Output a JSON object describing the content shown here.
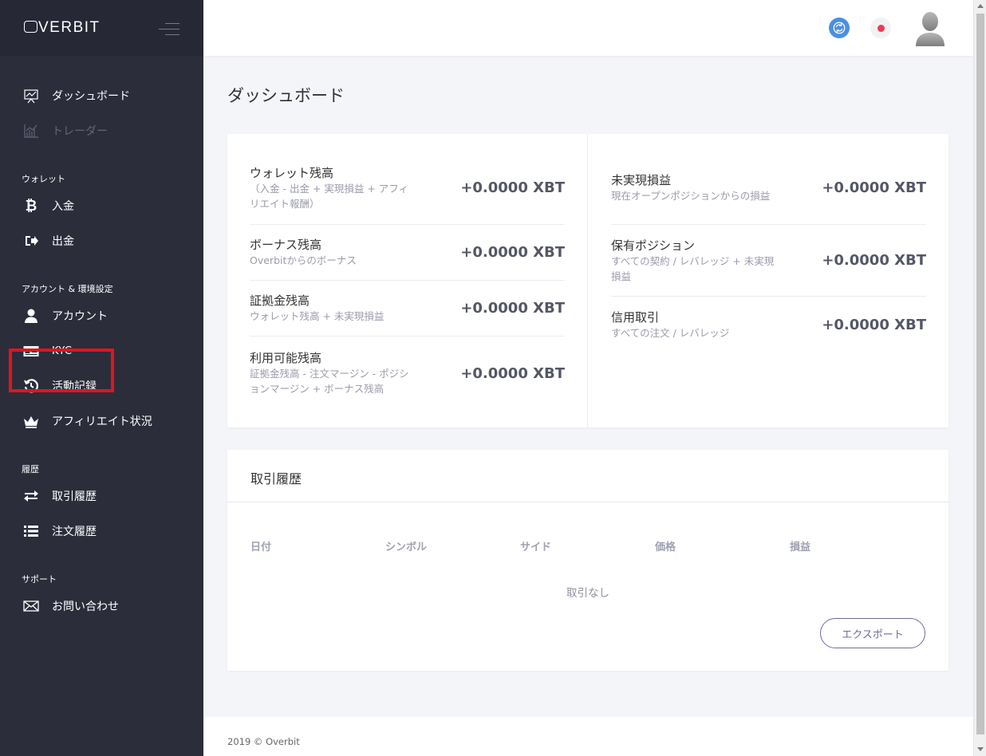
{
  "brand": {
    "logo": "VERBIT"
  },
  "sidebar": {
    "items": [
      {
        "label": "ダッシュボード",
        "icon": "chart-board-icon"
      },
      {
        "label": "トレーダー",
        "icon": "line-chart-icon"
      }
    ],
    "sections": [
      {
        "title": "ウォレット",
        "items": [
          {
            "label": "入金",
            "icon": "bitcoin-icon"
          },
          {
            "label": "出金",
            "icon": "sign-out-icon"
          }
        ]
      },
      {
        "title": "アカウント & 環境設定",
        "items": [
          {
            "label": "アカウント",
            "icon": "user-icon"
          },
          {
            "label": "KYC",
            "icon": "id-card-icon"
          },
          {
            "label": "活動記録",
            "icon": "history-icon"
          },
          {
            "label": "アフィリエイト状況",
            "icon": "crown-icon"
          }
        ]
      },
      {
        "title": "履歴",
        "items": [
          {
            "label": "取引履歴",
            "icon": "exchange-arrows-icon"
          },
          {
            "label": "注文履歴",
            "icon": "list-icon"
          }
        ]
      },
      {
        "title": "サポート",
        "items": [
          {
            "label": "お問い合わせ",
            "icon": "envelope-icon"
          }
        ]
      }
    ]
  },
  "header": {
    "icons": [
      "sync-icon",
      "status-dot-icon",
      "avatar-icon"
    ],
    "status_color": "#ed3a52",
    "sync_color": "#4a90e2"
  },
  "main": {
    "title": "ダッシュボード",
    "balances": {
      "left": [
        {
          "label": "ウォレット残高",
          "desc": "（入金 - 出金 + 実現損益 + アフィリエイト報酬）",
          "value": "+0.0000 XBT"
        },
        {
          "label": "ボーナス残高",
          "desc": "Overbitからのボーナス",
          "value": "+0.0000 XBT"
        },
        {
          "label": "証拠金残高",
          "desc": "ウォレット残高 + 未実現損益",
          "value": "+0.0000 XBT"
        },
        {
          "label": "利用可能残高",
          "desc": "証拠金残高 - 注文マージン - ポジションマージン + ボーナス残高",
          "value": "+0.0000 XBT"
        }
      ],
      "right": [
        {
          "label": "未実現損益",
          "desc": "現在オープンポジションからの損益",
          "value": "+0.0000 XBT"
        },
        {
          "label": "保有ポジション",
          "desc": "すべての契約 / レバレッジ + 未実現損益",
          "value": "+0.0000 XBT"
        },
        {
          "label": "信用取引",
          "desc": "すべての注文 / レバレッジ",
          "value": "+0.0000 XBT"
        }
      ]
    },
    "history": {
      "title": "取引履歴",
      "columns": [
        "日付",
        "シンボル",
        "サイド",
        "価格",
        "損益"
      ],
      "empty": "取引なし",
      "export_label": "エクスポート"
    }
  },
  "footer": {
    "text": "2019 © Overbit"
  }
}
